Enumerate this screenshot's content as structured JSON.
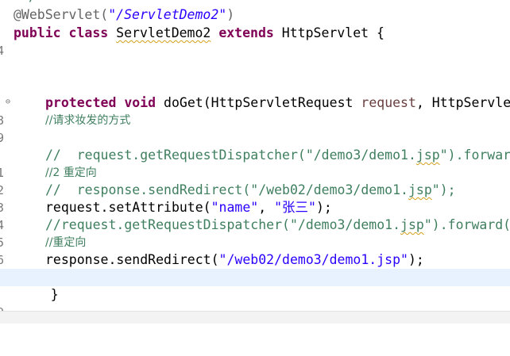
{
  "editor": {
    "lines": [
      {
        "num": "",
        "text": "/"
      },
      {
        "num": "",
        "annotation": "@WebServlet(",
        "path": "\"/ServletDemo2\"",
        "close": ")"
      },
      {
        "num": "4",
        "kw1": "public",
        "kw2": "class",
        "cls": "ServletDemo2",
        "kw3": "extends",
        "parent": "HttpServlet {"
      },
      {
        "num": "",
        "text": ""
      },
      {
        "num": "",
        "text": ""
      },
      {
        "num": "",
        "text": ""
      },
      {
        "num": "8",
        "kw1": "protected",
        "kw2": "void",
        "sig_a": "doGet(HttpServletRequest ",
        "param": "request",
        "sig_b": ", HttpServle"
      },
      {
        "num": "9",
        "comment": "//请求妆发的方式"
      },
      {
        "num": "",
        "text": ""
      },
      {
        "num": "1",
        "comment_a": "//  request.getRequestDispatcher(\"/demo3/demo1.",
        "comment_w": "jsp",
        "comment_b": "\").forwar"
      },
      {
        "num": "2",
        "comment": "//2 重定向"
      },
      {
        "num": "3",
        "comment_a": "//  response.sendRedirect(\"/web02/demo3/demo1.",
        "comment_w": "jsp",
        "comment_b": "\");"
      },
      {
        "num": "4",
        "obj": "request.setAttribute(",
        "s1": "\"name\"",
        "mid": ", ",
        "s2": "\"张三\"",
        "end": ");"
      },
      {
        "num": "5",
        "comment_a": "//request.getRequestDispatcher(\"/demo3/demo1.",
        "comment_w": "jsp",
        "comment_b": "\").forward("
      },
      {
        "num": "6",
        "comment": "//重定向"
      },
      {
        "num": "7",
        "obj": "response.sendRedirect(",
        "s1": "\"/web02/demo3/demo1.jsp\"",
        "end": ");"
      },
      {
        "num": "",
        "text": ""
      },
      {
        "num": "9",
        "text": "    }"
      }
    ]
  }
}
